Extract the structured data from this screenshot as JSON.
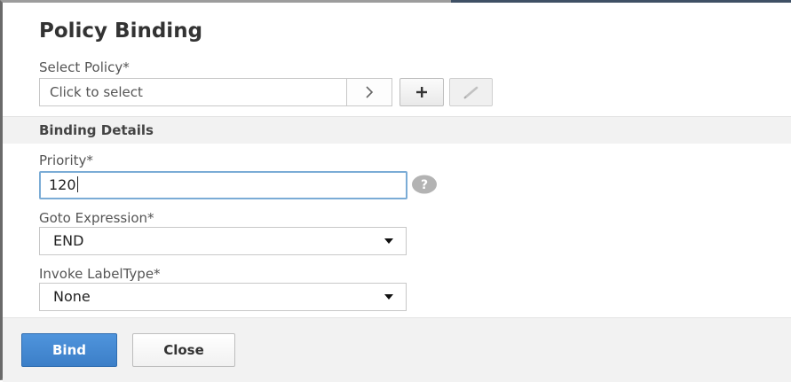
{
  "dialog": {
    "title": "Policy Binding"
  },
  "select_policy": {
    "label": "Select Policy*",
    "placeholder": "Click to select",
    "arrow_icon": "chevron-right-icon",
    "add_icon": "plus-icon",
    "edit_icon": "pencil-icon"
  },
  "binding_details": {
    "section_title": "Binding Details",
    "priority": {
      "label": "Priority*",
      "value": "120",
      "help_icon": "question-circle-icon"
    },
    "goto_expression": {
      "label": "Goto Expression*",
      "selected": "END"
    },
    "invoke_label_type": {
      "label": "Invoke LabelType*",
      "selected": "None"
    }
  },
  "footer": {
    "bind_label": "Bind",
    "close_label": "Close"
  },
  "colors": {
    "primary_button": "#4a8ed6",
    "focus_border": "#7bacd6",
    "section_background": "#f2f2f2",
    "help_icon": "#b3b3b3"
  }
}
